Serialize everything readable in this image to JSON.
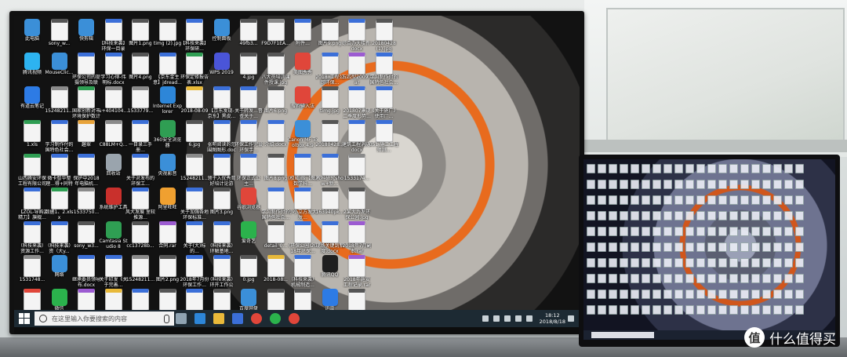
{
  "desktop": {
    "icons": [
      {
        "label": "此电脑",
        "color": "#3b8fd8",
        "kind": "app"
      },
      {
        "label": "腾讯视频",
        "color": "#2db3f0",
        "kind": "app"
      },
      {
        "label": "有道云笔记",
        "color": "#2d7be5",
        "kind": "app"
      },
      {
        "label": "1.xls",
        "color": "#2f9e53",
        "kind": "file"
      },
      {
        "label": "山西腾安环保工程有限公司",
        "color": "#2f9e53",
        "kind": "file"
      },
      {
        "label": "【ZOL-导购】精刀】旗舰...",
        "color": "#3b6fd8",
        "kind": "file"
      },
      {
        "label": "（科技来袭）资源工作...",
        "color": "#3b6fd8",
        "kind": "file"
      },
      {
        "label": "1531748...",
        "color": "#8a8a8a",
        "kind": "file"
      },
      {
        "label": "关于印发《关于完善...",
        "color": "#e0463a",
        "kind": "file"
      },
      {
        "label": "sony_w...",
        "color": "#555555",
        "kind": "file"
      },
      {
        "label": "MouseClic...",
        "color": "#3b8fd8",
        "kind": "app"
      },
      {
        "label": "15248211...",
        "color": "#8a8a8a",
        "kind": "file"
      },
      {
        "label": "学习制作付的国特色社会...",
        "color": "#3b6fd8",
        "kind": "file"
      },
      {
        "label": "微卡智华整理...得+同特体...",
        "color": "#3b6fd8",
        "kind": "file"
      },
      {
        "label": "数据1、2.xlsx",
        "color": "#2f9e53",
        "kind": "file"
      },
      {
        "label": "（科技来袭）资（大y...",
        "color": "#3b6fd8",
        "kind": "file"
      },
      {
        "label": "网络",
        "color": "#3b8fd8",
        "kind": "app"
      },
      {
        "label": "微信",
        "color": "#2bb24c",
        "kind": "app"
      },
      {
        "label": "快剪辑",
        "color": "#3b8fd8",
        "kind": "app"
      },
      {
        "label": "环保公司的提摄领导及联系...",
        "color": "#3b6fd8",
        "kind": "file"
      },
      {
        "label": "国家创新对市环境保护数计传.xls",
        "color": "#2f9e53",
        "kind": "file"
      },
      {
        "label": "趣翠",
        "color": "#e8a33a",
        "kind": "file"
      },
      {
        "label": "保护中2018年电脑机...",
        "color": "#3b6fd8",
        "kind": "file"
      },
      {
        "label": "1533750...",
        "color": "#8a8a8a",
        "kind": "file"
      },
      {
        "label": "sony_w3...",
        "color": "#555555",
        "kind": "file"
      },
      {
        "label": "继承委员领导布.docx",
        "color": "#3b6fd8",
        "kind": "file"
      },
      {
        "label": "环保一目录三手册.rar",
        "color": "#9c5bd1",
        "kind": "file"
      },
      {
        "label": "【科技来袭】环保一目录三...",
        "color": "#3b6fd8",
        "kind": "file"
      },
      {
        "label": "学习心得-伟明标.docx",
        "color": "#3b6fd8",
        "kind": "file"
      },
      {
        "label": "u+404104...",
        "color": "#8a8a8a",
        "kind": "file"
      },
      {
        "label": "C88LM+Q...",
        "color": "#8a8a8a",
        "kind": "file"
      },
      {
        "label": "回收站",
        "color": "#9aa4ad",
        "kind": "app"
      },
      {
        "label": "系统维护工具",
        "color": "#c9302c",
        "kind": "app"
      },
      {
        "label": "Camtasia Studio 8",
        "color": "#2f9e53",
        "kind": "app"
      },
      {
        "label": "关于印发《关于完善...",
        "color": "#3b6fd8",
        "kind": "file"
      },
      {
        "label": "2018-07-31",
        "color": "#e8b93a",
        "kind": "file"
      },
      {
        "label": "图片1.png",
        "color": "#555555",
        "kind": "file"
      },
      {
        "label": "图片4.png",
        "color": "#555555",
        "kind": "file"
      },
      {
        "label": "1533779...",
        "color": "#8a8a8a",
        "kind": "file"
      },
      {
        "label": "一目录三手册...",
        "color": "#3b6fd8",
        "kind": "file"
      },
      {
        "label": "关于对发布的环保工...",
        "color": "#3b6fd8",
        "kind": "file"
      },
      {
        "label": "风大发展 里较推源...",
        "color": "#3b6fd8",
        "kind": "file"
      },
      {
        "label": "cc13728b...",
        "color": "#555555",
        "kind": "file"
      },
      {
        "label": "15248211...",
        "color": "#8a8a8a",
        "kind": "file"
      },
      {
        "label": "公是原...卡利...",
        "color": "#3b6fd8",
        "kind": "file"
      },
      {
        "label": "timg (2).jpg",
        "color": "#555555",
        "kind": "file"
      },
      {
        "label": "【京东金主意】jdread...",
        "color": "#3b6fd8",
        "kind": "file"
      },
      {
        "label": "Internet Explorer",
        "color": "#2d86d8",
        "kind": "app"
      },
      {
        "label": "360安全浏览器",
        "color": "#2f9e53",
        "kind": "app"
      },
      {
        "label": "央视影音",
        "color": "#3b8fd8",
        "kind": "app"
      },
      {
        "label": "阿里旺旺",
        "color": "#f0a030",
        "kind": "app"
      },
      {
        "label": "合同.rar",
        "color": "#9c5bd1",
        "kind": "file"
      },
      {
        "label": "图片2.png",
        "color": "#555555",
        "kind": "file"
      },
      {
        "label": "图片5.png",
        "color": "#555555",
        "kind": "file"
      },
      {
        "label": "【科技来袭】环保研...",
        "color": "#3b6fd8",
        "kind": "file"
      },
      {
        "label": "环保定修报告表.xlsx",
        "color": "#2f9e53",
        "kind": "file"
      },
      {
        "label": "2018-08-09",
        "color": "#e8b93a",
        "kind": "file"
      },
      {
        "label": "6.jpg",
        "color": "#555555",
        "kind": "file"
      },
      {
        "label": "15248211...",
        "color": "#8a8a8a",
        "kind": "file"
      },
      {
        "label": "关于加强各地环保标准...",
        "color": "#3b6fd8",
        "kind": "file"
      },
      {
        "label": "关于(大)标的...",
        "color": "#3b6fd8",
        "kind": "file"
      },
      {
        "label": "2018年7月份环保工作...",
        "color": "#3b6fd8",
        "kind": "file"
      },
      {
        "label": "施工意见38号环保...",
        "color": "#3b6fd8",
        "kind": "file"
      },
      {
        "label": "控制面板",
        "color": "#3b8fd8",
        "kind": "app"
      },
      {
        "label": "WPS 2019",
        "color": "#4a55d8",
        "kind": "app"
      },
      {
        "label": "【京东发现-京东】黑皮...",
        "color": "#3b6fd8",
        "kind": "file"
      },
      {
        "label": "张明阅读的范围图图形.docx",
        "color": "#3b6fd8",
        "kind": "file"
      },
      {
        "label": "领于入优秀育好培计论游网...",
        "color": "#3b6fd8",
        "kind": "file"
      },
      {
        "label": "图片3.png",
        "color": "#555555",
        "kind": "file"
      },
      {
        "label": "（科技来袭）环解基地...",
        "color": "#3b6fd8",
        "kind": "file"
      },
      {
        "label": "（科技来袭）环开工作公园...",
        "color": "#3b6fd8",
        "kind": "file"
      },
      {
        "label": "图片7.png",
        "color": "#555555",
        "kind": "file"
      },
      {
        "label": "49fb3...",
        "color": "#555555",
        "kind": "file"
      },
      {
        "label": "4.jpg",
        "color": "#555555",
        "kind": "file"
      },
      {
        "label": "关于转发...督查关于...",
        "color": "#3b6fd8",
        "kind": "file"
      },
      {
        "label": "环保工作完设环保手...",
        "color": "#3b6fd8",
        "kind": "file"
      },
      {
        "label": "环保正式公主...",
        "color": "#3b6fd8",
        "kind": "file"
      },
      {
        "label": "谷歌浏览器",
        "color": "#e0463a",
        "kind": "app"
      },
      {
        "label": "爱奇艺",
        "color": "#2bb24c",
        "kind": "app"
      },
      {
        "label": "0.jpg",
        "color": "#555555",
        "kind": "file"
      },
      {
        "label": "百度网盘",
        "color": "#3b8fd8",
        "kind": "app"
      },
      {
        "label": "F9D7F1EA...",
        "color": "#8a8a8a",
        "kind": "file"
      },
      {
        "label": "八大员培训课件授课.jpg",
        "color": "#555555",
        "kind": "file"
      },
      {
        "label": "图片6.png",
        "color": "#555555",
        "kind": "file"
      },
      {
        "label": "介绍.docx",
        "color": "#3b6fd8",
        "kind": "file"
      },
      {
        "label": "图片8.png",
        "color": "#555555",
        "kind": "file"
      },
      {
        "label": "学习制作付的国特色社会...",
        "color": "#3b6fd8",
        "kind": "file"
      },
      {
        "label": "detail_0...",
        "color": "#555555",
        "kind": "file"
      },
      {
        "label": "2018-08...",
        "color": "#e8b93a",
        "kind": "file"
      },
      {
        "label": "16374d...",
        "color": "#555555",
        "kind": "file"
      },
      {
        "label": "附件...",
        "color": "#3b6fd8",
        "kind": "file"
      },
      {
        "label": "美图秀秀",
        "color": "#e0463a",
        "kind": "app"
      },
      {
        "label": "搜狗输入法",
        "color": "#e0463a",
        "kind": "app"
      },
      {
        "label": "Canon MF Toolbox 4.9",
        "color": "#3b8fd8",
        "kind": "app"
      },
      {
        "label": "(权威)版【图】数学科...",
        "color": "#3b6fd8",
        "kind": "file"
      },
      {
        "label": "小小立方发大发...",
        "color": "#3b6fd8",
        "kind": "file"
      },
      {
        "label": "(环保公园)2018年环保...",
        "color": "#3b6fd8",
        "kind": "file"
      },
      {
        "label": "（科技来袭）机械制造...",
        "color": "#3b6fd8",
        "kind": "file"
      },
      {
        "label": "QQ图片20180805...",
        "color": "#555555",
        "kind": "file"
      },
      {
        "label": "图片9.png",
        "color": "#555555",
        "kind": "file"
      },
      {
        "label": "2018_工程公司环保...",
        "color": "#3b6fd8",
        "kind": "file"
      },
      {
        "label": "timg.jpg",
        "color": "#555555",
        "kind": "file"
      },
      {
        "label": "20180428...",
        "color": "#555555",
        "kind": "file"
      },
      {
        "label": "教科研究show+新...",
        "color": "#3b6fd8",
        "kind": "file"
      },
      {
        "label": "163940pk...",
        "color": "#555555",
        "kind": "file"
      },
      {
        "label": "现场关键到新度.docx",
        "color": "#3b6fd8",
        "kind": "file"
      },
      {
        "label": "腾讯QQ",
        "color": "#1f1f1f",
        "kind": "app"
      },
      {
        "label": "迅雷",
        "color": "#2d7be5",
        "kind": "app"
      },
      {
        "label": "综合办大楼新.docx",
        "color": "#3b6fd8",
        "kind": "file"
      },
      {
        "label": "五四型2009.rar",
        "color": "#9c5bd1",
        "kind": "file"
      },
      {
        "label": "201807康现二季度形势...",
        "color": "#3b6fd8",
        "kind": "file"
      },
      {
        "label": "建筑工程消防.docx",
        "color": "#3b6fd8",
        "kind": "file"
      },
      {
        "label": "1533174...",
        "color": "#8a8a8a",
        "kind": "file"
      },
      {
        "label": "2某大力发环保公园.jpg",
        "color": "#555555",
        "kind": "file"
      },
      {
        "label": "2018年7月副本.rar",
        "color": "#9c5bd1",
        "kind": "file"
      },
      {
        "label": "2018年施安工程记录.rar",
        "color": "#9c5bd1",
        "kind": "file"
      },
      {
        "label": "timg (1).jpg",
        "color": "#555555",
        "kind": "file"
      },
      {
        "label": "20180428 (1).jpg",
        "color": "#555555",
        "kind": "file"
      },
      {
        "label": "学习制作付的国特色社会...",
        "color": "#3b6fd8",
        "kind": "file"
      },
      {
        "label": "《关于施广》使用厂...",
        "color": "#3b6fd8",
        "kind": "file"
      },
      {
        "label": "051-施工工程师测...",
        "color": "#3b6fd8",
        "kind": "file"
      }
    ]
  },
  "taskbar": {
    "search_placeholder": "在这里输入你要搜索的内容",
    "apps": [
      {
        "name": "task-view",
        "color": "#8fa3b2"
      },
      {
        "name": "browser",
        "color": "#2d86d8"
      },
      {
        "name": "file-explorer",
        "color": "#e8b93a"
      },
      {
        "name": "store",
        "color": "#3b6fd8"
      },
      {
        "name": "record",
        "color": "#e0463a"
      },
      {
        "name": "wechat",
        "color": "#2bb24c"
      },
      {
        "name": "chrome",
        "color": "#e0463a"
      }
    ],
    "clock": {
      "time": "18:12",
      "date": "2018/8/18"
    }
  },
  "watermark": {
    "logo": "值",
    "text": "什么值得买"
  }
}
